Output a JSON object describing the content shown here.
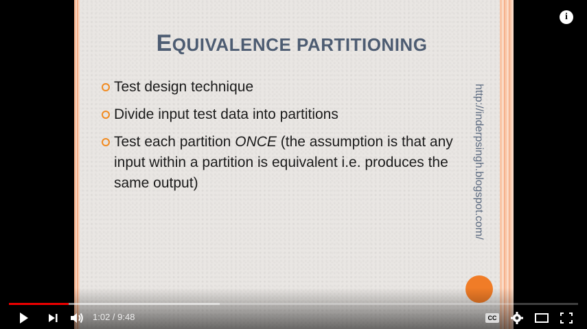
{
  "slide": {
    "title_first_letter": "E",
    "title_rest": "quivalence partitioning",
    "bullets": [
      {
        "text": "Test design technique"
      },
      {
        "text": "Divide input test data into partitions"
      },
      {
        "text_before": "Test each partition ",
        "emphasis": "ONCE",
        "text_after": " (the assumption is that any input within a partition is equivalent i.e. produces the same output)"
      }
    ],
    "side_url": "http://inderpsingh.blogspot.com/"
  },
  "player": {
    "time_display": "1:02 / 9:48",
    "played_fraction": 0.105,
    "loaded_fraction": 0.37,
    "cc_label": "CC",
    "colors": {
      "progress_played": "#e00000",
      "bullet": "#f28a1e",
      "title": "#4d5c72",
      "orange_circle": "#f07c27"
    }
  },
  "icons": {
    "info": "info-icon",
    "play": "play-icon",
    "next": "next-icon",
    "volume": "volume-icon",
    "cc": "cc-icon",
    "settings": "gear-icon",
    "theater": "theater-mode-icon",
    "fullscreen": "fullscreen-icon"
  }
}
